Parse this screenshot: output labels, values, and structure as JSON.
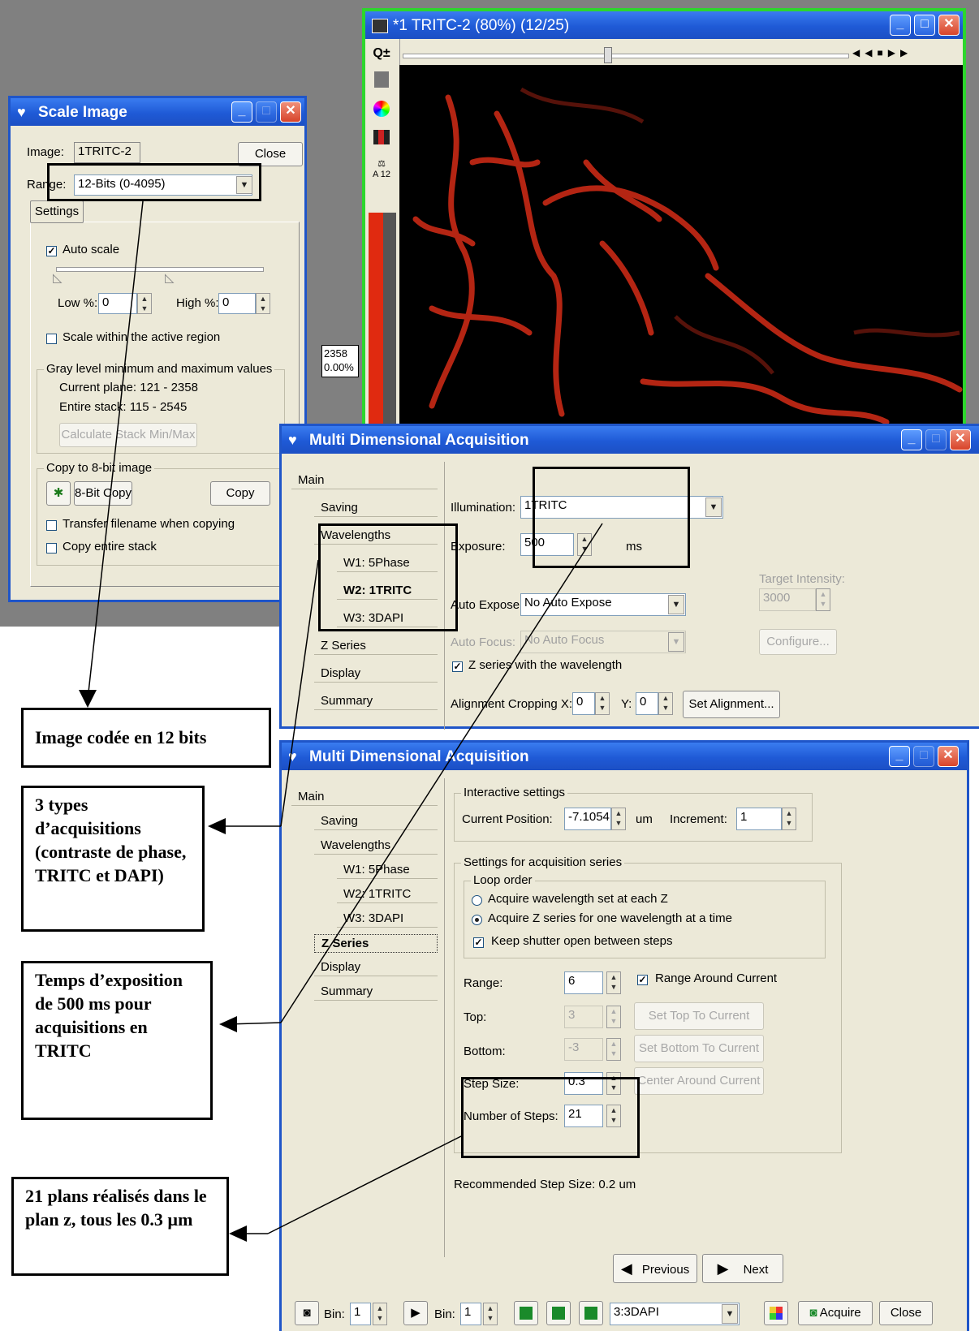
{
  "colors": {
    "titlebar": "#1f5ad6",
    "dialog_bg": "#ece9d8",
    "image_window_border": "#2dd62d",
    "signal": "#c82a16"
  },
  "image_window": {
    "title": "*1 TRITC-2 (80%) (12/25)",
    "zoom_icon": "Q±",
    "balance_label": "A 12",
    "intensity_value": "2358",
    "intensity_percent": "0.00%"
  },
  "scale_image": {
    "title": "Scale Image",
    "image_label": "Image:",
    "image_value": "1TRITC-2",
    "close_label": "Close",
    "range_label": "Range:",
    "range_value": "12-Bits (0-4095)",
    "tab_settings": "Settings",
    "auto_scale": "Auto scale",
    "low_label": "Low %:",
    "low_value": "0",
    "high_label": "High %:",
    "high_value": "0",
    "scale_within": "Scale within the active region",
    "gray_group": "Gray level minimum and maximum values",
    "current_plane": "Current plane:  121 - 2358",
    "entire_stack": "Entire stack:   115 - 2545",
    "calc_button": "Calculate Stack Min/Max",
    "copy_group": "Copy to 8-bit image",
    "eight_bit_copy": "8-Bit Copy",
    "copy": "Copy",
    "transfer_filename": "Transfer filename when copying",
    "copy_entire": "Copy entire stack"
  },
  "mda1": {
    "title": "Multi Dimensional Acquisition",
    "nav": [
      "Main",
      "Saving",
      "Wavelengths",
      "W1: 5Phase",
      "W2: 1TRITC",
      "W3: 3DAPI",
      "Z Series",
      "Display",
      "Summary"
    ],
    "illumination_label": "Illumination:",
    "illumination_value": "1TRITC",
    "exposure_label": "Exposure:",
    "exposure_value": "500",
    "exposure_unit": "ms",
    "target_label": "Target Intensity:",
    "target_value": "3000",
    "auto_expose_label": "Auto Expose:",
    "auto_expose_value": "No Auto Expose",
    "auto_focus_label": "Auto Focus:",
    "auto_focus_value": "No Auto Focus",
    "configure": "Configure...",
    "z_with_wavelength": "Z series with the wavelength",
    "align_label": "Alignment Cropping  X:",
    "align_x": "0",
    "align_y_label": "Y:",
    "align_y": "0",
    "set_alignment": "Set Alignment..."
  },
  "mda2": {
    "title": "Multi Dimensional Acquisition",
    "nav": [
      "Main",
      "Saving",
      "Wavelengths",
      "W1: 5Phase",
      "W2: 1TRITC",
      "W3: 3DAPI",
      "Z Series",
      "Display",
      "Summary"
    ],
    "interactive_group": "Interactive settings",
    "current_position_label": "Current Position:",
    "current_position_value": "-7.1054",
    "um": "um",
    "increment_label": "Increment:",
    "increment_value": "1",
    "series_group": "Settings for acquisition series",
    "loop_group": "Loop order",
    "radio1": "Acquire wavelength set at each Z",
    "radio2": "Acquire Z series for one wavelength at a time",
    "keep_shutter": "Keep shutter open between steps",
    "range_label": "Range:",
    "range_value": "6",
    "range_around": "Range Around Current",
    "top_label": "Top:",
    "top_value": "3",
    "set_top": "Set Top To Current",
    "bottom_label": "Bottom:",
    "bottom_value": "-3",
    "set_bottom": "Set Bottom To Current",
    "step_label": "Step Size:",
    "step_value": "0.3",
    "center_around": "Center Around Current",
    "steps_label": "Number of Steps:",
    "steps_value": "21",
    "recommended": "Recommended Step Size: 0.2 um",
    "previous": "Previous",
    "next": "Next",
    "bin1_label": "Bin:",
    "bin1_value": "1",
    "bin2_label": "Bin:",
    "bin2_value": "1",
    "wavelength_select": "3:3DAPI",
    "acquire": "Acquire",
    "close": "Close"
  },
  "callouts": {
    "c1": "Image codée en 12 bits",
    "c2": "3 types d’acquisitions (contraste de phase, TRITC et DAPI)",
    "c3": "Temps d’exposition de 500 ms pour acquisitions en TRITC",
    "c4": "21 plans réalisés dans le plan z, tous les 0.3 µm"
  }
}
